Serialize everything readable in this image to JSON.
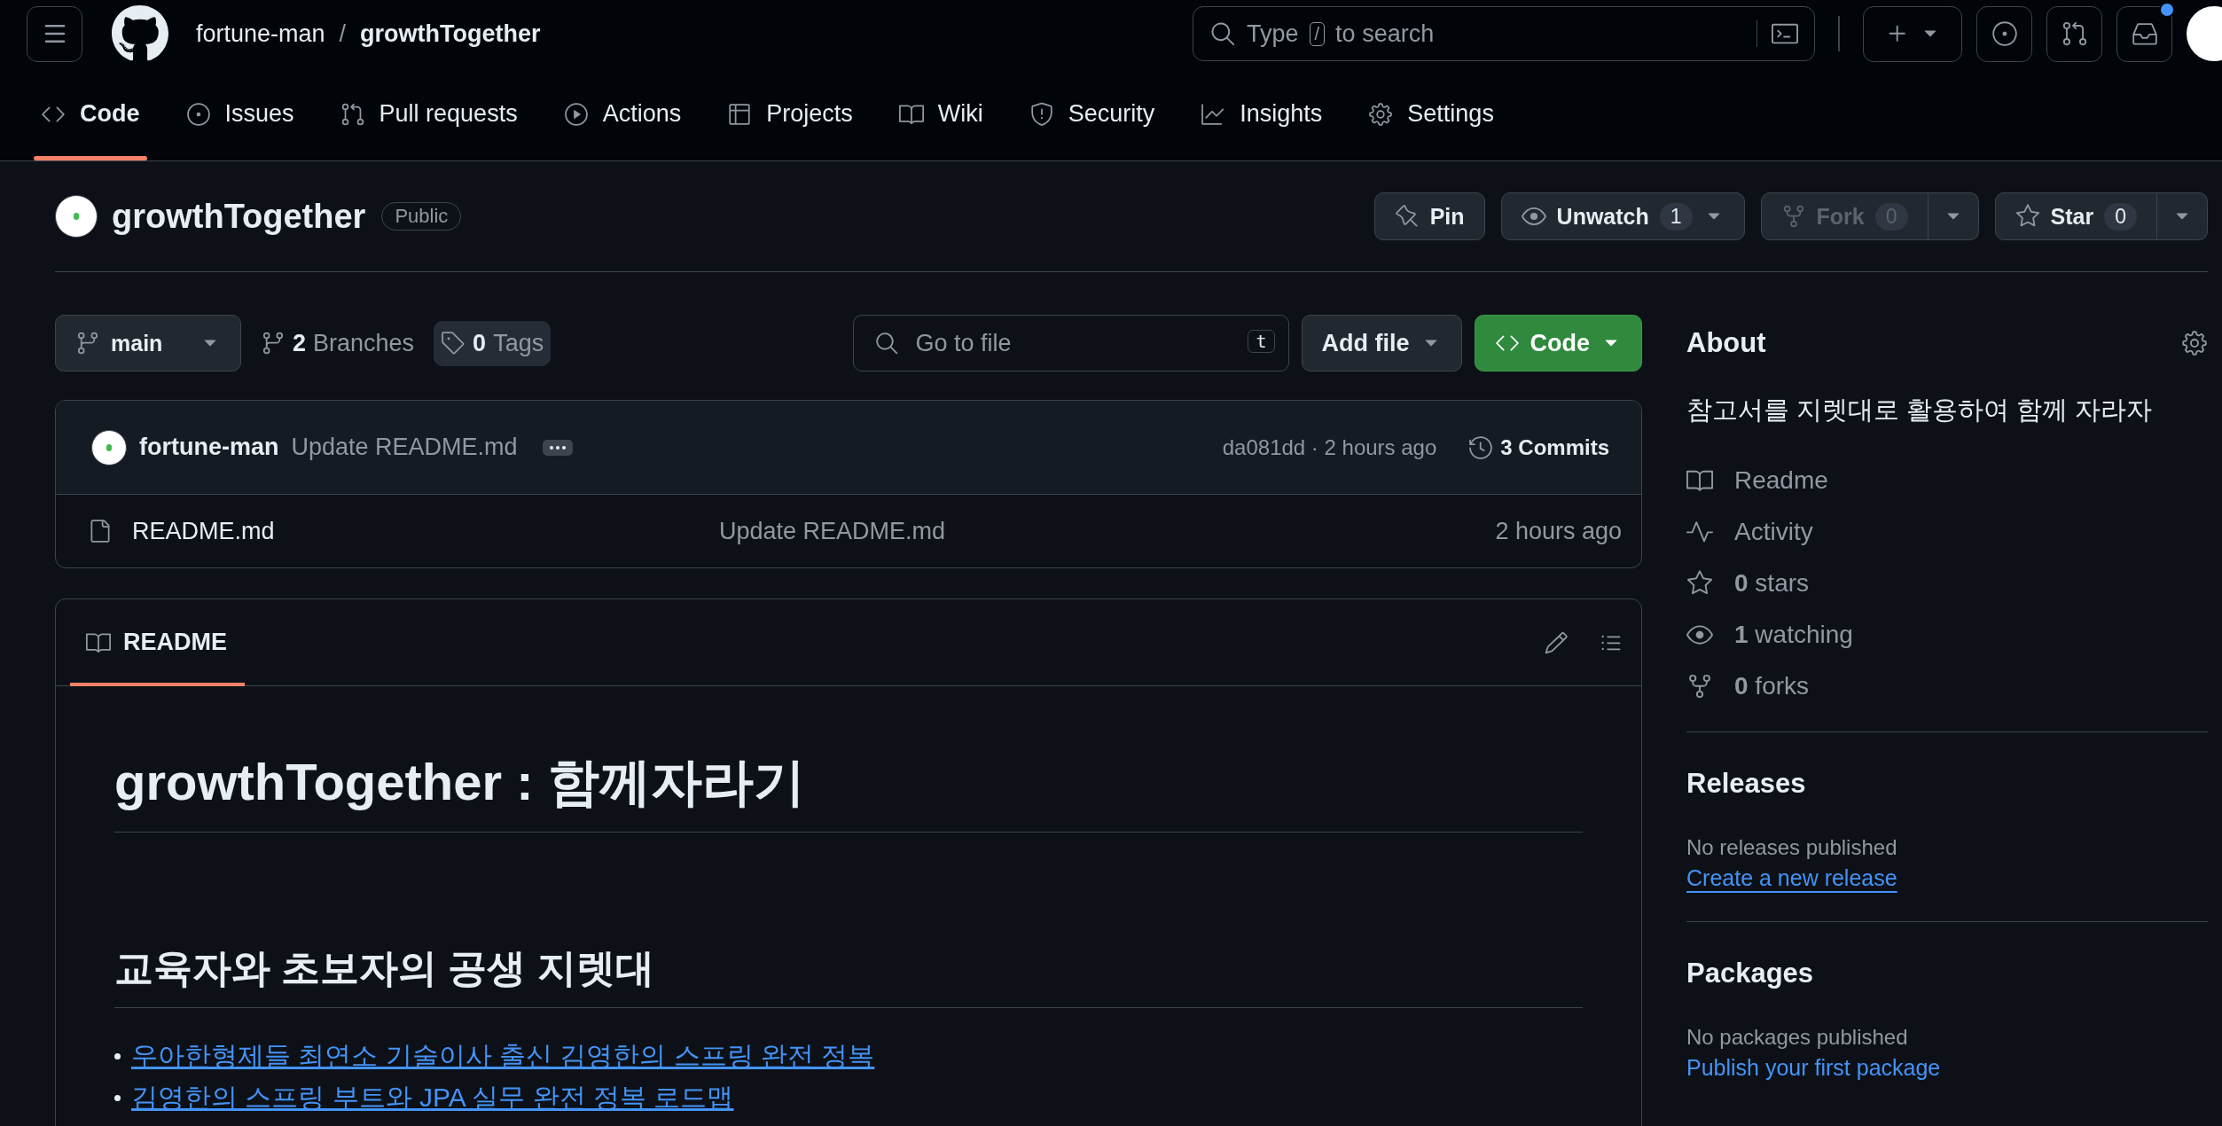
{
  "header": {
    "breadcrumb": [
      {
        "text": "fortune-man",
        "current": false
      },
      {
        "text": "growthTogether",
        "current": true
      }
    ],
    "separator": "/",
    "search": {
      "before": "Type",
      "key": "/",
      "after": "to search"
    },
    "inbox": {
      "unread": true
    }
  },
  "nav_tabs": [
    {
      "label": "Code",
      "selected": true
    },
    {
      "label": "Issues",
      "selected": false
    },
    {
      "label": "Pull requests",
      "selected": false
    },
    {
      "label": "Actions",
      "selected": false
    },
    {
      "label": "Projects",
      "selected": false
    },
    {
      "label": "Wiki",
      "selected": false
    },
    {
      "label": "Security",
      "selected": false
    },
    {
      "label": "Insights",
      "selected": false
    },
    {
      "label": "Settings",
      "selected": false
    }
  ],
  "repo": {
    "name": "growthTogether",
    "visibility": "Public",
    "pin": "Pin",
    "watch": {
      "label": "Unwatch",
      "count": "1"
    },
    "fork": {
      "label": "Fork",
      "count": "0",
      "disabled": true
    },
    "star": {
      "label": "Star",
      "count": "0"
    }
  },
  "toolbar": {
    "branch": "main",
    "branches": {
      "count": "2",
      "label": "Branches",
      "hovered": false
    },
    "tags": {
      "count": "0",
      "label": "Tags",
      "hovered": true
    },
    "go_to_file": {
      "placeholder": "Go to file",
      "shortcut": "t"
    },
    "add_file": "Add file",
    "code": "Code"
  },
  "latest_commit": {
    "author": "fortune-man",
    "message": "Update README.md",
    "meta": "da081dd · 2 hours ago",
    "commits": {
      "count": "3",
      "label": "Commits"
    }
  },
  "files": [
    {
      "name": "README.md",
      "message": "Update README.md",
      "time": "2 hours ago"
    }
  ],
  "readme": {
    "tab": {
      "label": "README",
      "selected": true
    },
    "title": "growthTogether : 함께자라기",
    "subtitle": "교육자와 초보자의 공생 지렛대",
    "links": [
      "우아한형제들 최연소 기술이사 출신 김영한의 스프링 완전 정복",
      "김영한의 스프링 부트와 JPA 실무 완전 정복 로드맵"
    ]
  },
  "sidebar": {
    "about": {
      "title": "About",
      "description": "참고서를 지렛대로 활용하여 함께 자라자",
      "items": [
        {
          "label": "Readme"
        },
        {
          "label": "Activity"
        },
        {
          "count": "0",
          "label": "stars"
        },
        {
          "count": "1",
          "label": "watching"
        },
        {
          "count": "0",
          "label": "forks"
        }
      ]
    },
    "releases": {
      "title": "Releases",
      "empty": "No releases published",
      "link": "Create a new release"
    },
    "packages": {
      "title": "Packages",
      "empty": "No packages published",
      "link": "Publish your first package"
    }
  }
}
